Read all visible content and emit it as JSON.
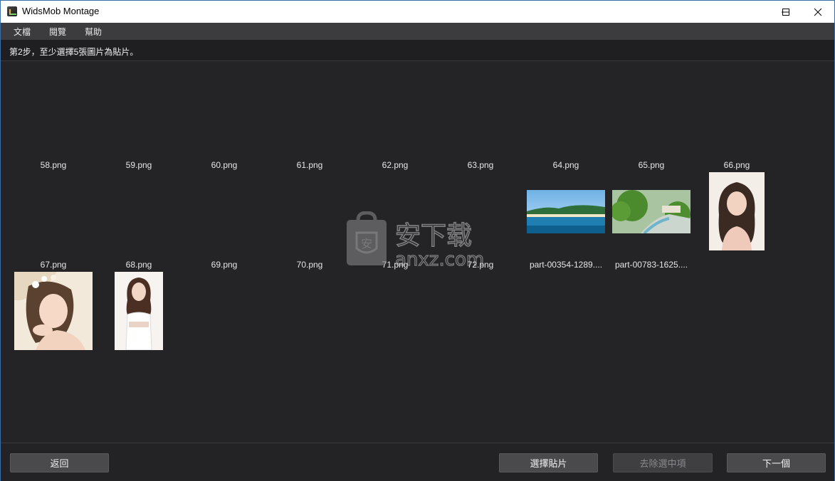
{
  "window": {
    "title": "WidsMob Montage"
  },
  "menu": [
    "文檔",
    "閱覽",
    "幫助"
  ],
  "instruction": "第2步，至少選擇5張圖片為貼片。",
  "files": [
    {
      "label": "58.png",
      "thumb": "none"
    },
    {
      "label": "59.png",
      "thumb": "none"
    },
    {
      "label": "60.png",
      "thumb": "none"
    },
    {
      "label": "61.png",
      "thumb": "none"
    },
    {
      "label": "62.png",
      "thumb": "none"
    },
    {
      "label": "63.png",
      "thumb": "none"
    },
    {
      "label": "64.png",
      "thumb": "beach-landscape"
    },
    {
      "label": "65.png",
      "thumb": "garden-landscape"
    },
    {
      "label": "66.png",
      "thumb": "portrait-woman"
    },
    {
      "label": "67.png",
      "thumb": "portrait-flowers"
    },
    {
      "label": "68.png",
      "thumb": "portrait-standing"
    },
    {
      "label": "69.png",
      "thumb": "none"
    },
    {
      "label": "70.png",
      "thumb": "none"
    },
    {
      "label": "71.png",
      "thumb": "none"
    },
    {
      "label": "72.png",
      "thumb": "none"
    },
    {
      "label": "part-00354-1289....",
      "thumb": "none"
    },
    {
      "label": "part-00783-1625....",
      "thumb": "none"
    }
  ],
  "watermark": {
    "main": "安下载",
    "sub": "anxz.com"
  },
  "footer": {
    "back_label": "返回",
    "select_label": "選擇貼片",
    "remove_label": "去除選中項",
    "next_label": "下一個"
  },
  "colors": {
    "background": "#242426",
    "menubar": "#3c3c3e",
    "button": "#4a4a4d",
    "text": "#e6e6e6"
  }
}
